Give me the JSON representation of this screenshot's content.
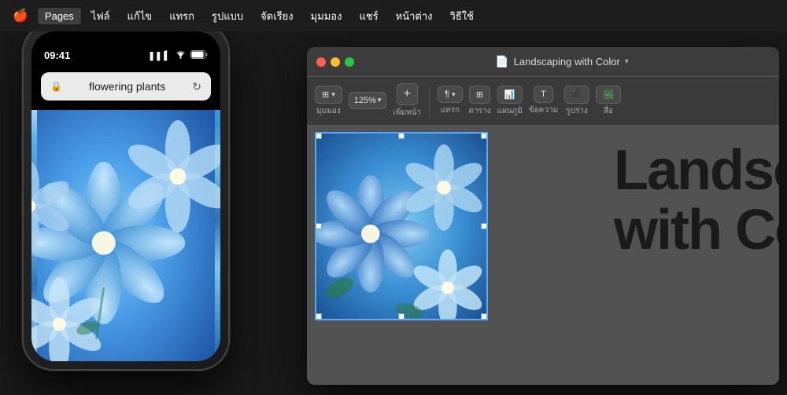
{
  "mac": {
    "menubar": {
      "apple": "🍎",
      "items": [
        {
          "label": "Pages",
          "active": true
        },
        {
          "label": "ไฟล์",
          "active": false
        },
        {
          "label": "แก้ไข",
          "active": false
        },
        {
          "label": "แทรก",
          "active": false
        },
        {
          "label": "รูปแบบ",
          "active": false
        },
        {
          "label": "จัดเรียง",
          "active": false
        },
        {
          "label": "มุมมอง",
          "active": false
        },
        {
          "label": "แชร์",
          "active": false
        },
        {
          "label": "หน้าต่าง",
          "active": false
        },
        {
          "label": "วิธีใช้",
          "active": false
        }
      ]
    }
  },
  "pages_window": {
    "title": "Landscaping with Color",
    "doc_icon": "📄",
    "toolbar": {
      "view_label": "มุมมอง",
      "zoom_value": "125%",
      "add_page_label": "เพิ่มหน้า",
      "insert_label": "แทรก",
      "table_label": "ตาราง",
      "chart_label": "แผนภูมิ",
      "text_label": "ข้อความ",
      "shape_label": "รูปร่าง",
      "media_label": "สื่อ"
    },
    "doc_text_line1": "Landscapi",
    "doc_text_line2": "with Color"
  },
  "iphone": {
    "status_bar": {
      "time": "09:41",
      "signal": "▌▌▌",
      "wifi": "WiFi",
      "battery": "🔋"
    },
    "address_bar": {
      "lock_icon": "🔒",
      "url": "flowering plants",
      "reload_icon": "↻"
    }
  }
}
